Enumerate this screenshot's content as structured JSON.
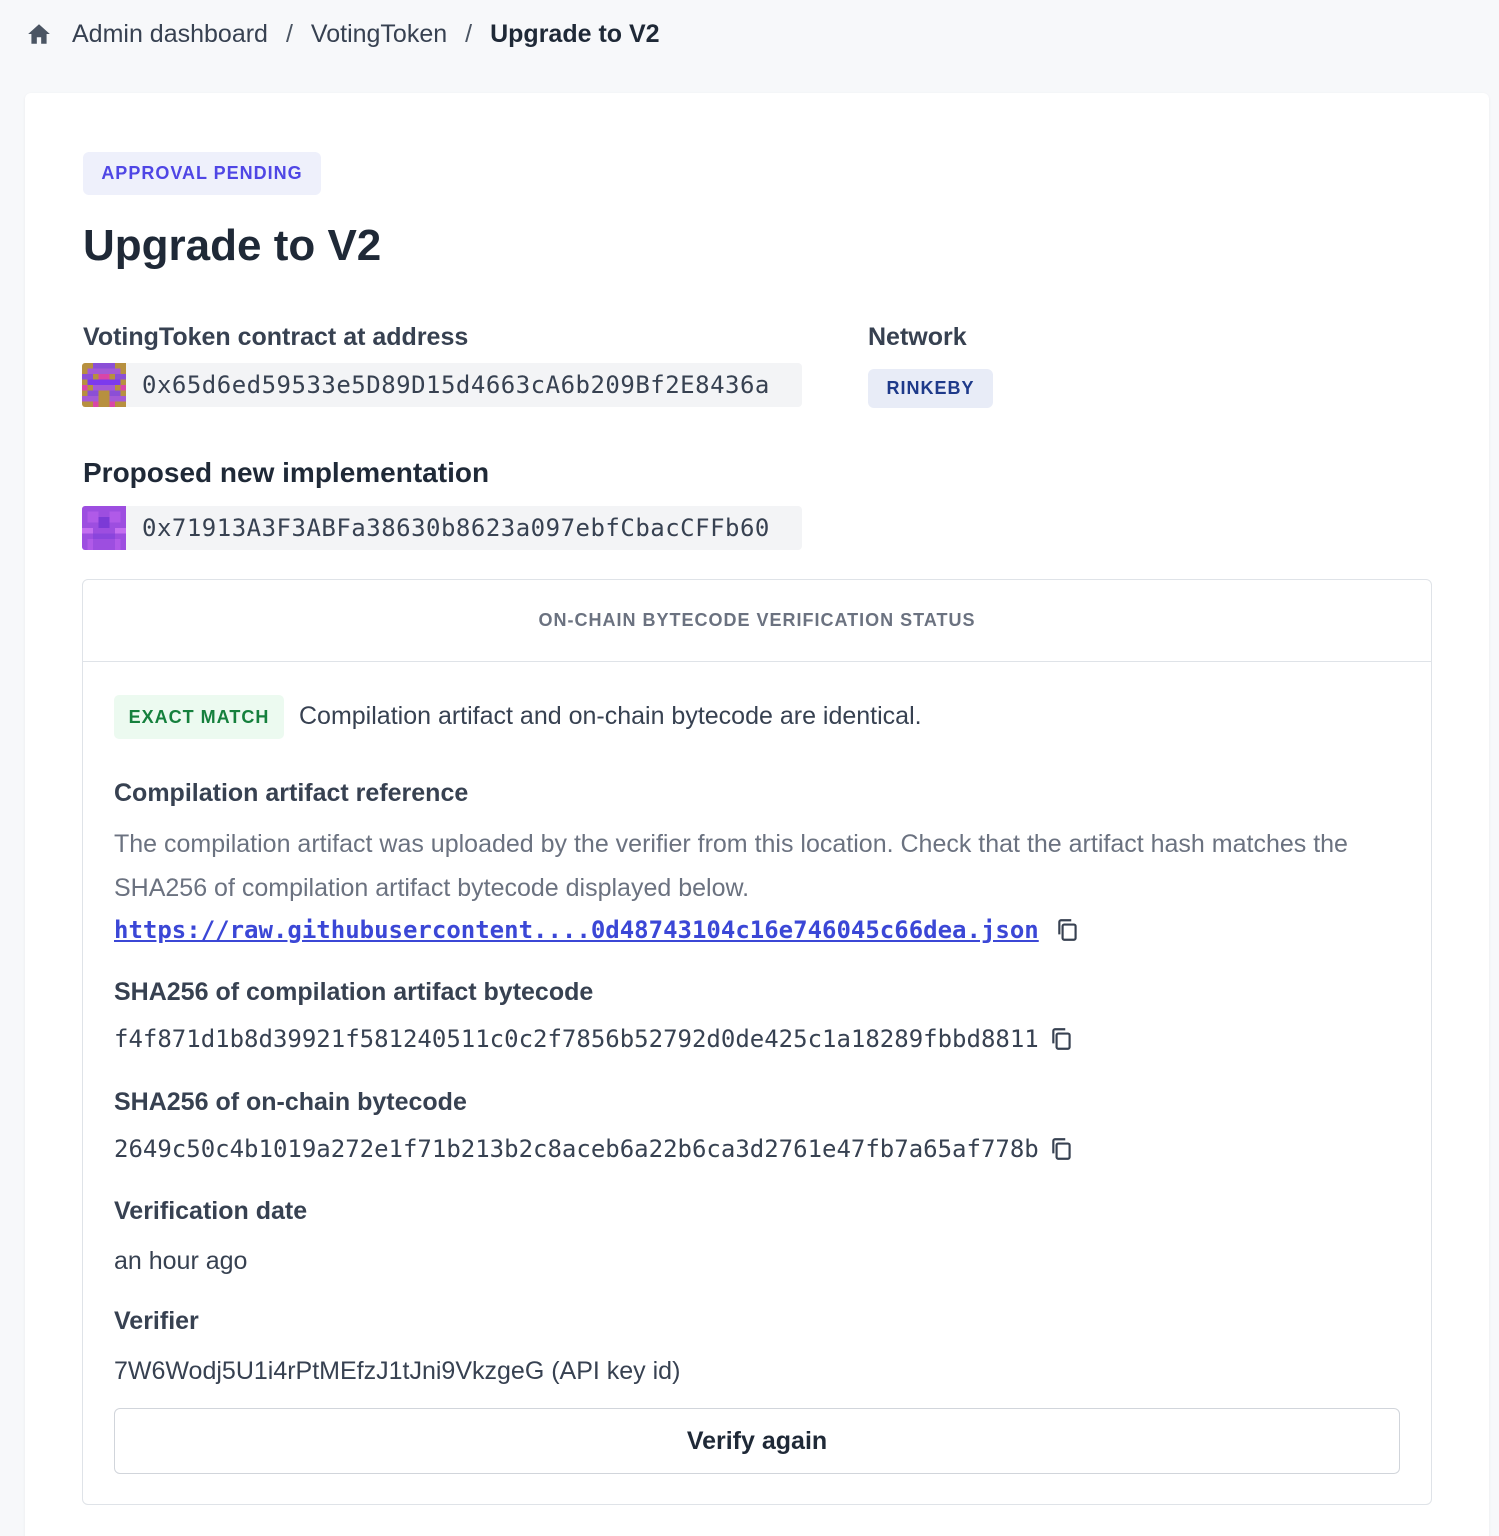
{
  "breadcrumb": {
    "home_icon": "home-icon",
    "items": [
      "Admin dashboard",
      "VotingToken",
      "Upgrade to V2"
    ],
    "separator": "/"
  },
  "proposal": {
    "status": "APPROVAL PENDING",
    "title": "Upgrade to V2",
    "contract_label": "VotingToken contract at address",
    "contract_address": "0x65d6ed59533e5D89D15d4663cA6b209Bf2E8436a",
    "network_label": "Network",
    "network": "RINKEBY",
    "implementation_label": "Proposed new implementation",
    "implementation_address": "0x71913A3F3ABFa38630b8623a097ebfCbacCFFb60"
  },
  "verification": {
    "header": "ON-CHAIN BYTECODE VERIFICATION STATUS",
    "match_status": "EXACT MATCH",
    "match_description": "Compilation artifact and on-chain bytecode are identical.",
    "artifact_label": "Compilation artifact reference",
    "artifact_description": "The compilation artifact was uploaded by the verifier from this location. Check that the artifact hash matches the SHA256 of compilation artifact bytecode displayed below.",
    "artifact_url": "https://raw.githubusercontent....0d48743104c16e746045c66dea.json",
    "artifact_sha_label": "SHA256 of compilation artifact bytecode",
    "artifact_sha": "f4f871d1b8d39921f581240511c0c2f7856b52792d0de425c1a18289fbbd8811",
    "onchain_sha_label": "SHA256 of on-chain bytecode",
    "onchain_sha": "2649c50c4b1019a272e1f71b213b2c8aceb6a22b6ca3d2761e47fb7a65af778b",
    "date_label": "Verification date",
    "date": "an hour ago",
    "verifier_label": "Verifier",
    "verifier": "7W6Wodj5U1i4rPtMEfzJ1tJni9VkzgeG (API key id)",
    "verify_button": "Verify again"
  },
  "colors": {
    "accent": "#4f46e5",
    "link": "#3b47d6",
    "success": "#15803d",
    "network": "#1e3a8a"
  }
}
